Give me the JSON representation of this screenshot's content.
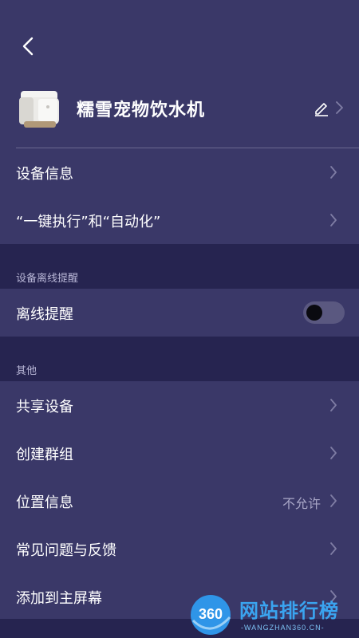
{
  "colors": {
    "background": "#3a3868",
    "section_background": "#262450",
    "text": "#ffffff",
    "muted_text": "#a9a7c7",
    "watermark_blue": "#3aa4f0"
  },
  "header": {
    "back_icon": "chevron-left-icon"
  },
  "device": {
    "name": "糯雪宠物饮水机",
    "image": "pet-water-dispenser-image",
    "edit_icon": "pencil-icon"
  },
  "rows_top": [
    {
      "label": "设备信息"
    },
    {
      "label": "“一键执行”和“自动化”"
    }
  ],
  "offline_section": {
    "title": "设备离线提醒",
    "row_label": "离线提醒",
    "toggle_on": false
  },
  "other_section": {
    "title": "其他",
    "rows": [
      {
        "label": "共享设备",
        "value": ""
      },
      {
        "label": "创建群组",
        "value": ""
      },
      {
        "label": "位置信息",
        "value": "不允许"
      },
      {
        "label": "常见问题与反馈",
        "value": ""
      },
      {
        "label": "添加到主屏幕",
        "value": ""
      }
    ]
  },
  "watermark": {
    "logo_text": "360",
    "title": "网站排行榜",
    "subtitle": "-WANGZHAN360.CN-"
  }
}
